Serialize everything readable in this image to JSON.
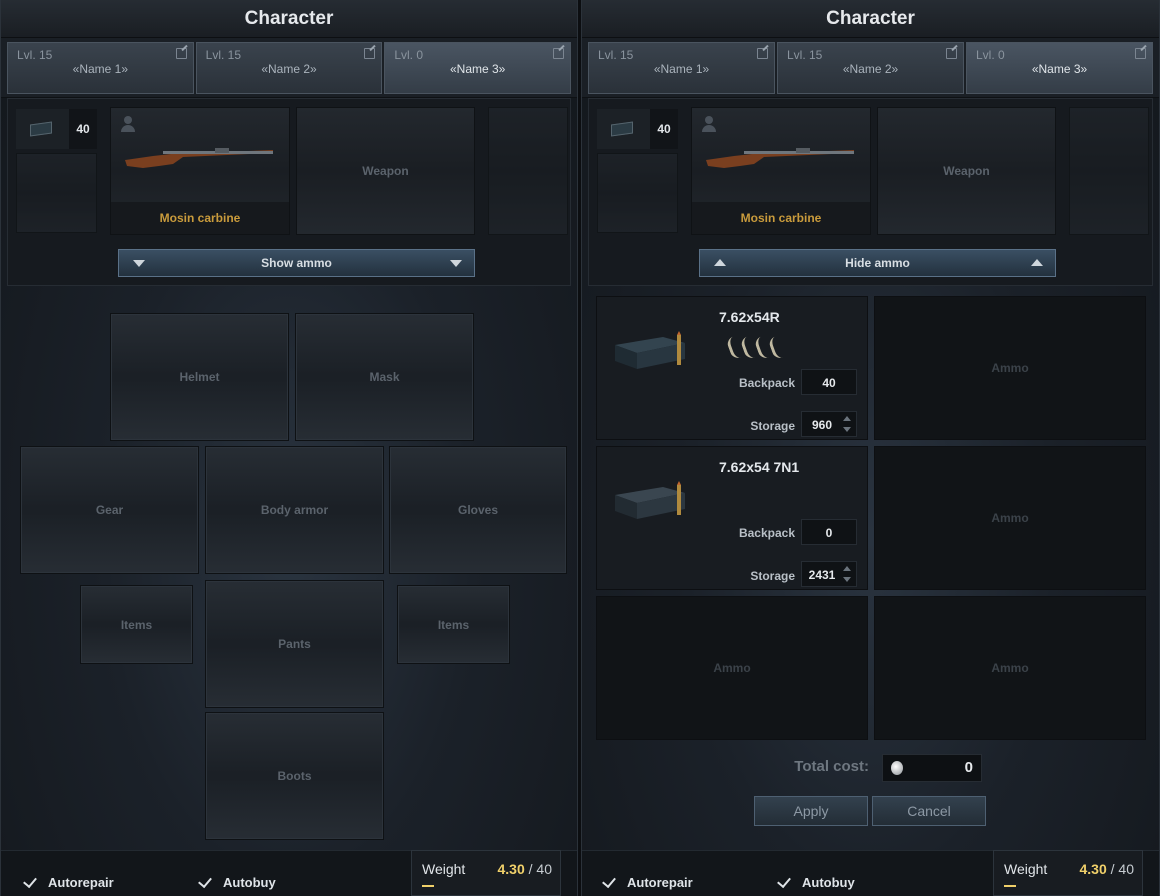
{
  "colors": {
    "accent": "#c99b3c",
    "weight_value": "#f0d06a",
    "background": "#13171c"
  },
  "left": {
    "title": "Character",
    "characters": [
      {
        "level": "Lvl. 15",
        "name": "«Name 1»"
      },
      {
        "level": "Lvl. 15",
        "name": "«Name 2»"
      },
      {
        "level": "Lvl. 0",
        "name": "«Name 3»"
      }
    ],
    "ammo_count": "40",
    "weapon_name": "Mosin carbine",
    "weapon_slot_label": "Weapon",
    "ammo_toggle_label": "Show ammo",
    "slots": {
      "helmet": "Helmet",
      "mask": "Mask",
      "gear": "Gear",
      "body_armor": "Body armor",
      "gloves": "Gloves",
      "items_left": "Items",
      "pants": "Pants",
      "items_right": "Items",
      "boots": "Boots"
    },
    "footer": {
      "autorepair": "Autorepair",
      "autobuy": "Autobuy",
      "weight_label": "Weight",
      "weight_value": "4.30",
      "weight_max": "/ 40"
    }
  },
  "right": {
    "title": "Character",
    "characters": [
      {
        "level": "Lvl. 15",
        "name": "«Name 1»"
      },
      {
        "level": "Lvl. 15",
        "name": "«Name 2»"
      },
      {
        "level": "Lvl. 0",
        "name": "«Name 3»"
      }
    ],
    "ammo_count": "40",
    "weapon_name": "Mosin carbine",
    "weapon_slot_label": "Weapon",
    "ammo_toggle_label": "Hide ammo",
    "ammo": [
      {
        "name": "7.62x54R",
        "backpack_label": "Backpack",
        "backpack": "40",
        "storage_label": "Storage",
        "storage": "960"
      },
      {
        "name": "7.62x54 7N1",
        "backpack_label": "Backpack",
        "backpack": "0",
        "storage_label": "Storage",
        "storage": "2431"
      }
    ],
    "empty_ammo_label": "Ammo",
    "total_cost_label": "Total cost:",
    "total_cost": "0",
    "apply_label": "Apply",
    "cancel_label": "Cancel",
    "footer": {
      "autorepair": "Autorepair",
      "autobuy": "Autobuy",
      "weight_label": "Weight",
      "weight_value": "4.30",
      "weight_max": "/ 40"
    }
  }
}
